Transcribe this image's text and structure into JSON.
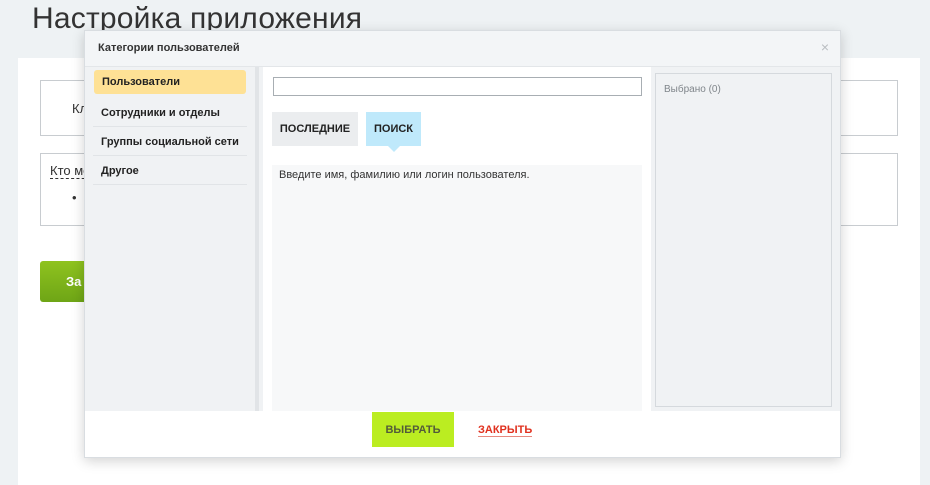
{
  "page": {
    "title": "Настройка приложения",
    "box1_text": "Кл",
    "box2_link": "Кто мо",
    "bullet": "•",
    "green_button": "За"
  },
  "dialog": {
    "title": "Категории пользователей",
    "close_icon": "×",
    "sidebar": {
      "items": [
        {
          "label": "Пользователи",
          "active": true
        },
        {
          "label": "Сотрудники и отделы",
          "active": false
        },
        {
          "label": "Группы социальной сети",
          "active": false
        },
        {
          "label": "Другое",
          "active": false
        }
      ]
    },
    "search": {
      "value": "",
      "placeholder": ""
    },
    "tabs": {
      "recent": "ПОСЛЕДНИЕ",
      "search": "ПОИСК"
    },
    "results_hint": "Введите имя, фамилию или логин пользователя.",
    "selected_label": "Выбрано (0)",
    "footer": {
      "select_button": "ВЫБРАТЬ",
      "close_link": "ЗАКРЫТЬ"
    }
  },
  "colors": {
    "active_item": "#fee195",
    "search_tab": "#bfe9fb",
    "select_button": "#bbed21",
    "close_link": "#e0301e"
  }
}
